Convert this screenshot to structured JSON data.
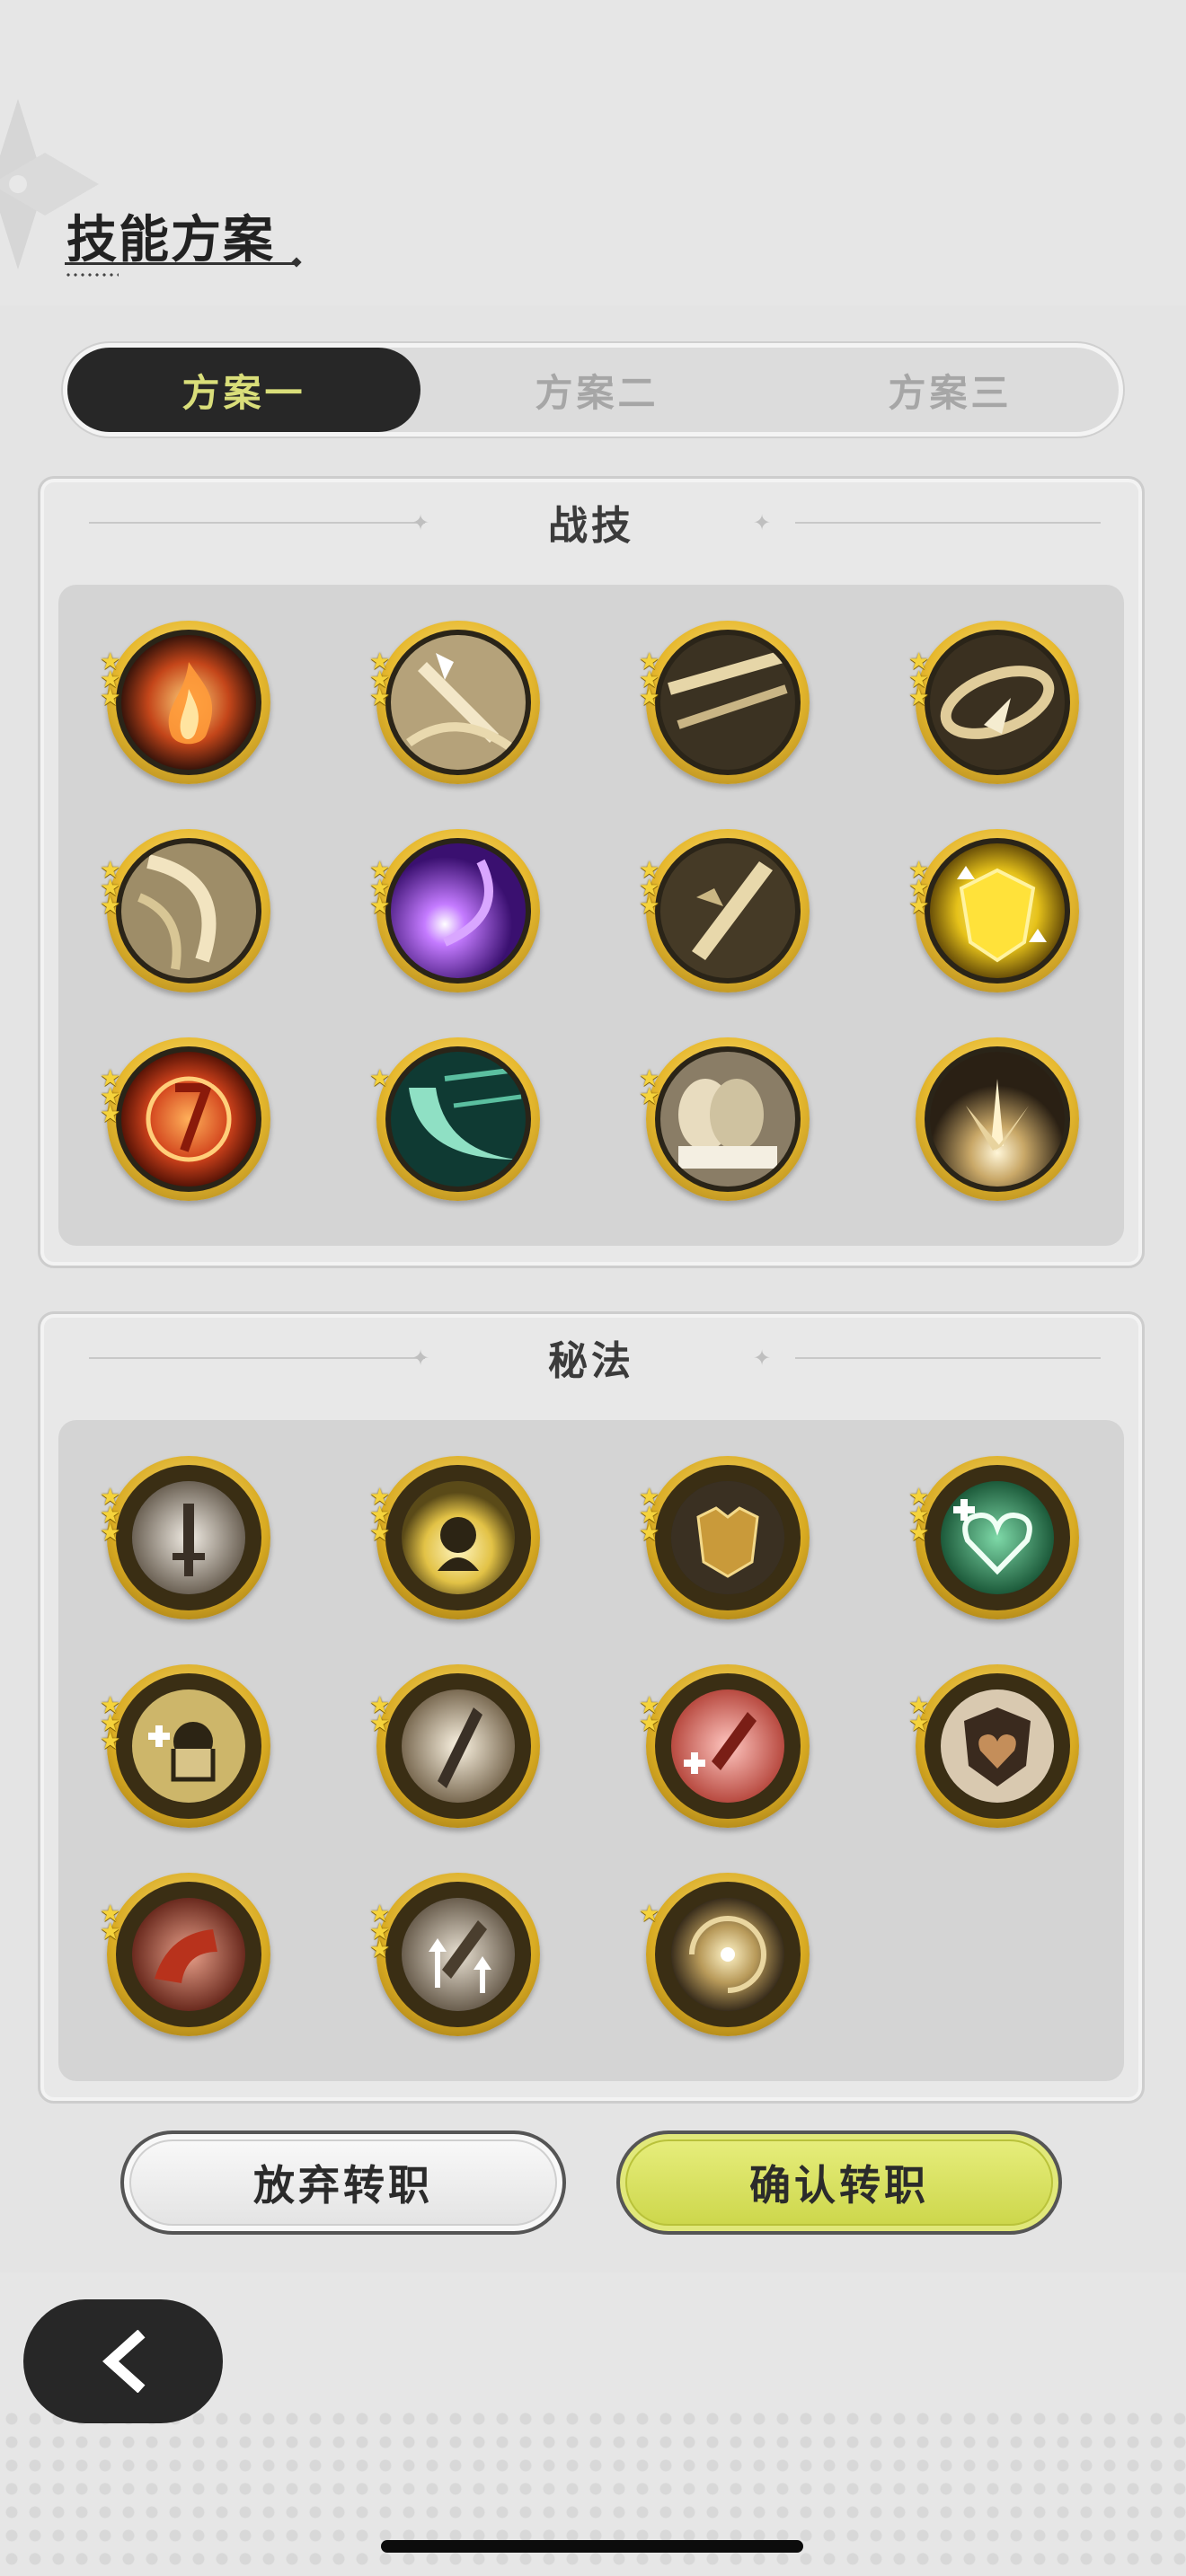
{
  "header": {
    "title": "技能方案"
  },
  "tabs": [
    {
      "label": "方案一",
      "active": true
    },
    {
      "label": "方案二",
      "active": false
    },
    {
      "label": "方案三",
      "active": false
    }
  ],
  "combat_skills": {
    "title": "战技",
    "items": [
      {
        "icon": "flame-icon",
        "stars": 3
      },
      {
        "icon": "sword-strike-icon",
        "stars": 3
      },
      {
        "icon": "slash-icon",
        "stars": 3
      },
      {
        "icon": "whirlwind-icon",
        "stars": 3
      },
      {
        "icon": "spin-slash-icon",
        "stars": 3
      },
      {
        "icon": "arcane-orb-icon",
        "stars": 3
      },
      {
        "icon": "cross-slash-icon",
        "stars": 3
      },
      {
        "icon": "golden-shield-up-icon",
        "stars": 3
      },
      {
        "icon": "fire-sigil-icon",
        "stars": 3
      },
      {
        "icon": "wind-crescent-icon",
        "stars": 1
      },
      {
        "icon": "charge-icon",
        "stars": 2
      },
      {
        "icon": "ground-blast-icon",
        "stars": 0
      }
    ]
  },
  "secret_arts": {
    "title": "秘法",
    "items": [
      {
        "icon": "sword-emblem-icon",
        "stars": 3
      },
      {
        "icon": "spirit-icon",
        "stars": 3
      },
      {
        "icon": "armor-icon",
        "stars": 3
      },
      {
        "icon": "heart-heal-icon",
        "stars": 3
      },
      {
        "icon": "shield-heal-icon",
        "stars": 3
      },
      {
        "icon": "blade-icon",
        "stars": 2
      },
      {
        "icon": "sword-heal-icon",
        "stars": 2
      },
      {
        "icon": "heart-shield-icon",
        "stars": 2
      },
      {
        "icon": "crimson-wave-icon",
        "stars": 2
      },
      {
        "icon": "sword-up-icon",
        "stars": 3
      },
      {
        "icon": "vortex-icon",
        "stars": 1
      }
    ]
  },
  "actions": {
    "abandon_label": "放弃转职",
    "confirm_label": "确认转职"
  },
  "navigation": {
    "back_icon": "chevron-left-icon"
  },
  "colors": {
    "background": "#e4e4e4",
    "tab_active_bg": "#272727",
    "tab_active_text": "#d9de7a",
    "confirm_button": "#d8e05a",
    "gold_frame": "#e7b92e"
  }
}
